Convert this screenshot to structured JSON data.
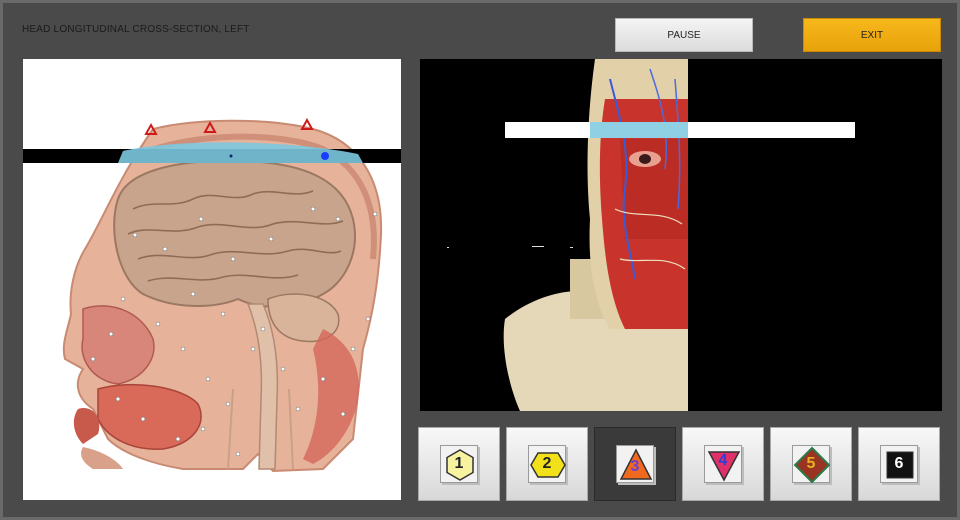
{
  "title": "HEAD LONGITUDINAL CROSS-SECTION, LEFT",
  "controls": {
    "pause_label": "PAUSE",
    "exit_label": "EXIT"
  },
  "views": [
    {
      "label": "1",
      "shape": "hexagon",
      "fill": "#f7f3a0",
      "text_color": "#222222"
    },
    {
      "label": "2",
      "shape": "hexagon",
      "fill": "#f2e01a",
      "text_color": "#222222"
    },
    {
      "label": "3",
      "shape": "triangle-up",
      "fill": "#ef6a1e",
      "text_color": "#6b3fd0",
      "active": true
    },
    {
      "label": "4",
      "shape": "triangle-down",
      "fill": "#e0306a",
      "text_color": "#2b3fd8"
    },
    {
      "label": "5",
      "shape": "diamond",
      "fill": "#9a3422",
      "text_color": "#e8b020"
    },
    {
      "label": "6",
      "shape": "square",
      "fill": "#111111",
      "text_color": "#ffffff"
    }
  ],
  "colors": {
    "accent": "#f0ac10",
    "background": "#4a4a4a",
    "slice_highlight": "#7cc8e0"
  }
}
